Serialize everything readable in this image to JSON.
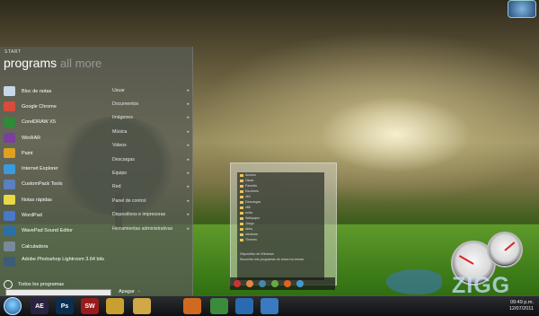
{
  "start_menu": {
    "label": "START",
    "title": "programs",
    "title_alt": "all more",
    "programs": [
      {
        "label": "Bloc de notas",
        "color": "#c9d7e6"
      },
      {
        "label": "Google Chrome",
        "color": "#d94b3a"
      },
      {
        "label": "CorelDRAW X5",
        "color": "#2f8a3a"
      },
      {
        "label": "WinRAR",
        "color": "#7b3f9c"
      },
      {
        "label": "Paint",
        "color": "#e0a020"
      },
      {
        "label": "Internet Explorer",
        "color": "#3a9bdc"
      },
      {
        "label": "CustomPack Tools",
        "color": "#5a80c0"
      },
      {
        "label": "Notas rápidas",
        "color": "#e8d84a"
      },
      {
        "label": "WordPad",
        "color": "#4a78c8"
      },
      {
        "label": "WavePad Sound Editor",
        "color": "#2a6fa8"
      },
      {
        "label": "Calculadora",
        "color": "#7a8a9a"
      },
      {
        "label": "Adobe Photoshop Lightroom 3.64 bits",
        "color": "#3c5c78"
      }
    ],
    "all_programs": "Todos los programas",
    "links": [
      "Usuar",
      "Documentos",
      "Imágenes",
      "Música",
      "Videos",
      "Descargas",
      "Equipo",
      "Red",
      "Panel de control",
      "Dispositivos e impresoras",
      "Herramientas administrativas"
    ],
    "shutdown_label": "Apagar"
  },
  "mini_explorer": {
    "items": [
      "Acceso",
      "Usuar",
      "Favorito",
      "Escritorio",
      "x64",
      "Descargas",
      "x86",
      "extra",
      "Wallpaper",
      "Juego",
      "skins",
      "windows",
      "Themes"
    ],
    "footer": [
      "Dispositivo de Windows",
      "Escuchar mis programas de todos los temas"
    ]
  },
  "watermark": "ZIGG",
  "taskbar": {
    "items": [
      {
        "name": "after-effects",
        "label": "AE",
        "color": "#2a2340"
      },
      {
        "name": "photoshop",
        "label": "Ps",
        "color": "#0b2d4e"
      },
      {
        "name": "reader",
        "label": "SW",
        "color": "#9a1b1b"
      },
      {
        "name": "chrome",
        "label": "",
        "color": "#c8a030"
      },
      {
        "name": "explorer",
        "label": "",
        "color": "#d0a848"
      },
      {
        "name": "firefox",
        "label": "",
        "color": "#d06a20"
      },
      {
        "name": "messenger",
        "label": "",
        "color": "#3c8a3c"
      },
      {
        "name": "media-center",
        "label": "",
        "color": "#2a6ab0"
      },
      {
        "name": "network",
        "label": "",
        "color": "#3a7ac0"
      }
    ],
    "clock_time": "09:49 p.m.",
    "clock_date": "12/07/2011"
  }
}
